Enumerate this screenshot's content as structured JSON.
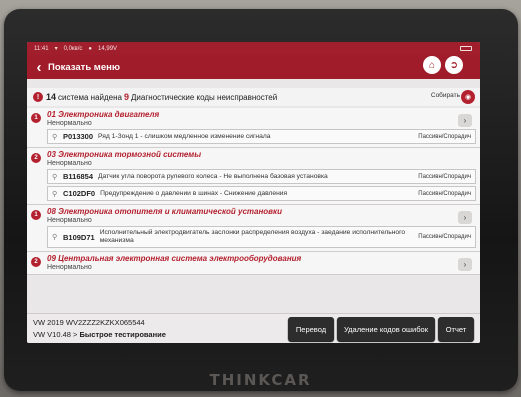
{
  "device": {
    "brand": "THINKCAR"
  },
  "status_bar": {
    "time": "11:41",
    "speed": "0,0кв/с",
    "voltage": "14,99V"
  },
  "header": {
    "back_glyph": "‹",
    "title": "Показать меню",
    "home_icon": "home-icon",
    "exit_icon": "exit-icon"
  },
  "summary": {
    "systems_count": "14",
    "systems_text": "система найдена",
    "codes_count": "9",
    "codes_text": "Диагностические коды неисправностей",
    "collect_label": "Собирать",
    "camera_icon": "camera-icon"
  },
  "systems": [
    {
      "index": "1",
      "name": "01 Электроника двигателя",
      "status": "Ненормально",
      "dtcs": [
        {
          "code": "P013300",
          "description": "Ряд 1-Зонд 1 - слишком медленное изменение сигнала",
          "state": "Пассивн/Спорадич"
        }
      ]
    },
    {
      "index": "2",
      "name": "03 Электроника тормозной системы",
      "status": "Ненормально",
      "dtcs": [
        {
          "code": "B116854",
          "description": "Датчик угла поворота рулевого колеса - Не выполнена базовая установка",
          "state": "Пассивн/Спорадич"
        },
        {
          "code": "C102DF0",
          "description": "Предупреждение о давлении в шинах - Снижение давления",
          "state": "Пассивн/Спорадич"
        }
      ]
    },
    {
      "index": "1",
      "name": "08 Электроника отопителя и климатической установки",
      "status": "Ненормально",
      "dtcs": [
        {
          "code": "B109D71",
          "description": "Исполнительный электродвигатель заслонки распределения воздуха - заедание исполнительного механизма",
          "state": "Пассивн/Спорадич"
        }
      ]
    },
    {
      "index": "2",
      "name": "09 Центральная электронная система электрооборудования",
      "status": "Ненормально",
      "dtcs": []
    }
  ],
  "footer": {
    "vehicle_line": "VW  2019  WV2ZZZ2KZKX065544",
    "software_prefix": "VW V10.48 >",
    "software_mode": "Быстрое тестирование",
    "translate_label": "Перевод",
    "clear_label": "Удаление кодов ошибок",
    "report_label": "Отчет"
  }
}
